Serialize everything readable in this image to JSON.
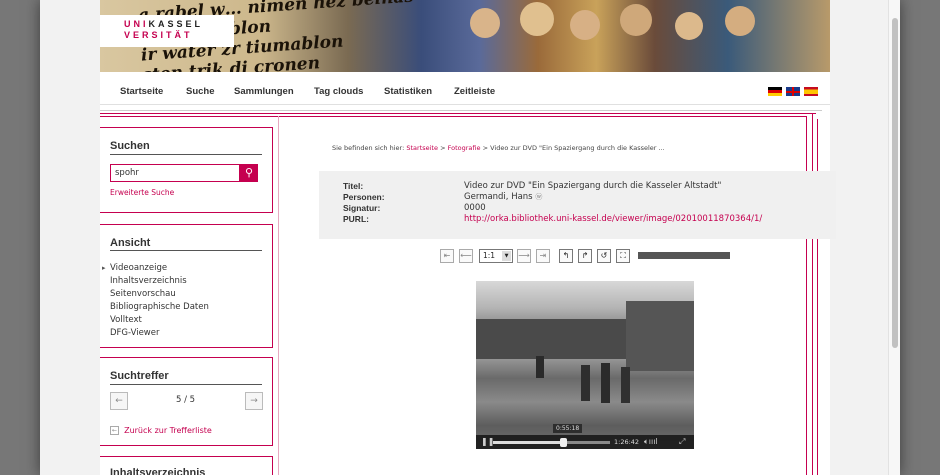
{
  "logo": {
    "line1_a": "UNI",
    "line1_b": "KASSEL",
    "line2_a": "VERSITÄT"
  },
  "banner": {
    "script_text": "a rabel w… nimen hez belnas\ndiz tiumablon\nir water zr tiumablon\nsten trik di cronen"
  },
  "nav": {
    "items": [
      "Startseite",
      "Suche",
      "Sammlungen",
      "Tag clouds",
      "Statistiken",
      "Zeitleiste"
    ]
  },
  "languages": [
    "de",
    "en",
    "es"
  ],
  "sidebar": {
    "search": {
      "title": "Suchen",
      "value": "spohr",
      "button_icon": "search-icon",
      "advanced_link": "Erweiterte Suche"
    },
    "ansicht": {
      "title": "Ansicht",
      "items": [
        "Videoanzeige",
        "Inhaltsverzeichnis",
        "Seitenvorschau",
        "Bibliographische Daten",
        "Volltext",
        "DFG-Viewer"
      ],
      "active": "Videoanzeige"
    },
    "hits": {
      "title": "Suchtreffer",
      "counter": "5 / 5",
      "back_link": "Zurück zur Trefferliste"
    },
    "toc": {
      "title": "Inhaltsverzeichnis"
    }
  },
  "breadcrumb": {
    "prefix": "Sie befinden sich hier:",
    "items": [
      "Startseite",
      "Fotografie"
    ],
    "current": "Video zur DVD \"Ein Spaziergang durch die Kasseler ...",
    "separator": ">"
  },
  "metadata": {
    "title_label": "Titel:",
    "title_value": "Video zur DVD \"Ein Spaziergang durch die Kasseler Altstadt\"",
    "persons_label": "Personen:",
    "persons_value": "Germandi, Hans",
    "signature_label": "Signatur:",
    "signature_value": "0000",
    "purl_label": "PURL:",
    "purl_value": "http://orka.bibliothek.uni-kassel.de/viewer/image/02010011870364/1/"
  },
  "toolbar": {
    "zoom_value": "1:1"
  },
  "video": {
    "hover_time": "0:55:18",
    "duration": "1:26:42",
    "progress": 0.6
  },
  "colors": {
    "accent": "#c5004f"
  }
}
